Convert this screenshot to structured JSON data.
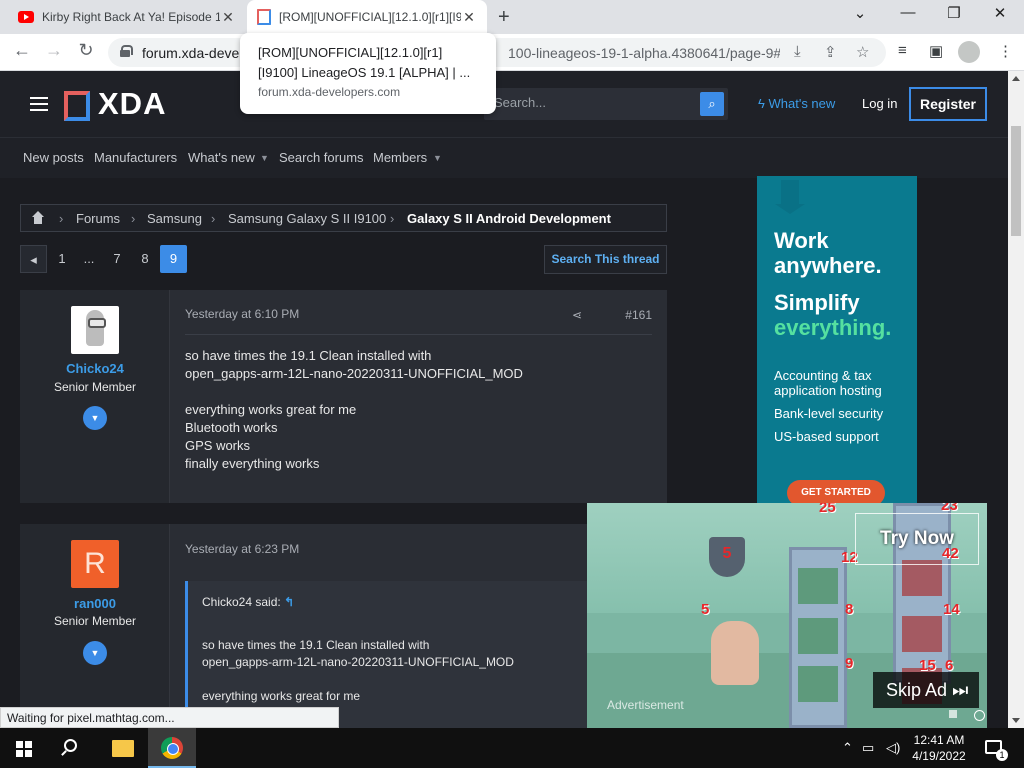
{
  "browser": {
    "tabs": [
      {
        "title": "Kirby Right Back At Ya! Episode 1",
        "favicon": "youtube-icon",
        "active": false
      },
      {
        "title": "[ROM][UNOFFICIAL][12.1.0][r1][I9",
        "favicon": "xda-icon",
        "active": true
      }
    ],
    "new_tab_label": "+",
    "window_controls": {
      "dropdown": "⌄",
      "minimize": "—",
      "restore": "❐",
      "close": "✕"
    },
    "url_domain": "forum.xda-develo",
    "url_path": "100-lineageos-19-1-alpha.4380641/page-9#...",
    "hover_card": {
      "title_line1": "[ROM][UNOFFICIAL][12.1.0][r1]",
      "title_line2": "[I9100] LineageOS 19.1 [ALPHA] | ...",
      "domain": "forum.xda-developers.com"
    }
  },
  "site": {
    "logo_text": "XDA",
    "search_placeholder": "Search...",
    "whats_new": "What's new",
    "login": "Log in",
    "register": "Register",
    "nav": [
      "New posts",
      "Manufacturers",
      "What's new",
      "Search forums",
      "Members"
    ]
  },
  "breadcrumb": {
    "items": [
      "Forums",
      "Samsung",
      "Samsung Galaxy S II I9100"
    ],
    "current": "Galaxy S II Android Development"
  },
  "pager": {
    "pages": [
      "1",
      "...",
      "7",
      "8"
    ],
    "current": "9",
    "search_thread": "Search This thread"
  },
  "posts": [
    {
      "username": "Chicko24",
      "role": "Senior Member",
      "time": "Yesterday at 6:10 PM",
      "number": "#161",
      "lines": [
        "so have times the 19.1 Clean installed with",
        "open_gapps-arm-12L-nano-20220311-UNOFFICIAL_MOD",
        "",
        "everything works great for me",
        "Bluetooth works",
        "GPS works",
        "finally everything works"
      ]
    },
    {
      "username": "ran000",
      "avatar_letter": "R",
      "role": "Senior Member",
      "time": "Yesterday at 6:23 PM",
      "quote": {
        "author": "Chicko24 said:",
        "lines": [
          "so have times the 19.1 Clean installed with",
          "open_gapps-arm-12L-nano-20220311-UNOFFICIAL_MOD",
          "",
          "everything works great for me"
        ]
      }
    }
  ],
  "side_ad": {
    "headline1": "Work",
    "headline2": "anywhere.",
    "headline3": "Simplify",
    "headline4": "everything.",
    "features": [
      "Accounting & tax",
      "application hosting",
      "Bank-level security",
      "US-based support"
    ],
    "cta": "GET STARTED"
  },
  "video_ad": {
    "try_now": "Try Now",
    "skip_ad": "Skip Ad",
    "label": "Advertisement",
    "shield_value": "5",
    "hero_value": "5",
    "numbers": [
      "23",
      "12",
      "8",
      "9",
      "42",
      "14",
      "15",
      "6",
      "25"
    ]
  },
  "status_text": "Waiting for pixel.mathtag.com...",
  "taskbar": {
    "time": "12:41 AM",
    "date": "4/19/2022",
    "notifications": "1"
  },
  "colors": {
    "accent": "#3c8ce7",
    "page_bg": "#1b1c21",
    "post_bg": "#2a2d34",
    "ad_teal": "#0a7a8f",
    "ad_green": "#55e0a0",
    "cta_orange": "#e2572e"
  }
}
